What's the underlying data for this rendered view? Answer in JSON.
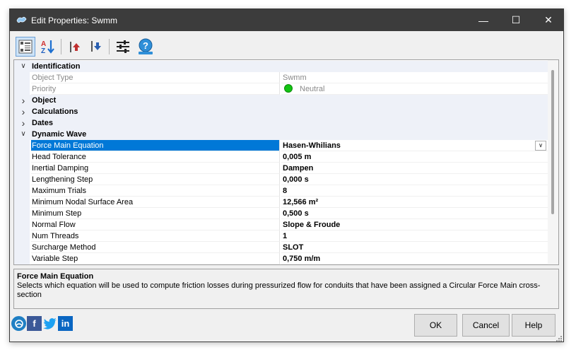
{
  "window": {
    "title": "Edit Properties: Swmm",
    "minimize_glyph": "—",
    "maximize_glyph": "☐",
    "close_glyph": "✕"
  },
  "toolbar": {
    "buttons": [
      {
        "name": "categorized-view-icon",
        "active": true
      },
      {
        "name": "sort-alphabetical-icon",
        "active": false
      },
      {
        "name": "move-up-icon",
        "active": false
      },
      {
        "name": "move-down-icon",
        "active": false
      },
      {
        "name": "settings-sliders-icon",
        "active": false
      },
      {
        "name": "help-icon",
        "active": false
      }
    ]
  },
  "grid": {
    "rows": [
      {
        "kind": "category",
        "expanded": true,
        "name": "Identification"
      },
      {
        "kind": "prop",
        "readonly": true,
        "name": "Object Type",
        "value": "Swmm"
      },
      {
        "kind": "prop",
        "readonly": true,
        "name": "Priority",
        "value": "Neutral",
        "dot_color": "#12c412"
      },
      {
        "kind": "category",
        "expanded": false,
        "name": "Object"
      },
      {
        "kind": "category",
        "expanded": false,
        "name": "Calculations"
      },
      {
        "kind": "category",
        "expanded": false,
        "name": "Dates"
      },
      {
        "kind": "category",
        "expanded": true,
        "name": "Dynamic Wave"
      },
      {
        "kind": "prop",
        "selected": true,
        "name": "Force Main Equation",
        "value": "Hasen-Whilians",
        "dropdown": true
      },
      {
        "kind": "prop",
        "name": "Head Tolerance",
        "value": "0,005 m"
      },
      {
        "kind": "prop",
        "name": "Inertial Damping",
        "value": "Dampen"
      },
      {
        "kind": "prop",
        "name": "Lengthening Step",
        "value": "0,000 s"
      },
      {
        "kind": "prop",
        "name": "Maximum Trials",
        "value": "8"
      },
      {
        "kind": "prop",
        "name": "Minimum Nodal Surface Area",
        "value": "12,566 m²"
      },
      {
        "kind": "prop",
        "name": "Minimum Step",
        "value": "0,500 s"
      },
      {
        "kind": "prop",
        "name": "Normal Flow",
        "value": "Slope & Froude"
      },
      {
        "kind": "prop",
        "name": "Num Threads",
        "value": "1"
      },
      {
        "kind": "prop",
        "name": "Surcharge Method",
        "value": "SLOT"
      },
      {
        "kind": "prop",
        "name": "Variable Step",
        "value": "0,750 m/m"
      }
    ]
  },
  "description": {
    "title": "Force Main Equation",
    "text": "Selects which equation will be used to compute friction losses during pressurized flow for conduits that have been assigned a Circular Force Main cross-section"
  },
  "social": [
    {
      "name": "website-icon",
      "label": "",
      "color": "#1f7fc4"
    },
    {
      "name": "facebook-icon",
      "label": "f",
      "color": "#3b5998"
    },
    {
      "name": "twitter-icon",
      "label": "",
      "color": "#1da1f2"
    },
    {
      "name": "linkedin-icon",
      "label": "in",
      "color": "#0a66c2"
    }
  ],
  "buttons": {
    "ok": "OK",
    "cancel": "Cancel",
    "help": "Help"
  },
  "colors": {
    "selection": "#0078d7",
    "category_bg": "#eef1f8",
    "titlebar": "#3c3c3c"
  }
}
